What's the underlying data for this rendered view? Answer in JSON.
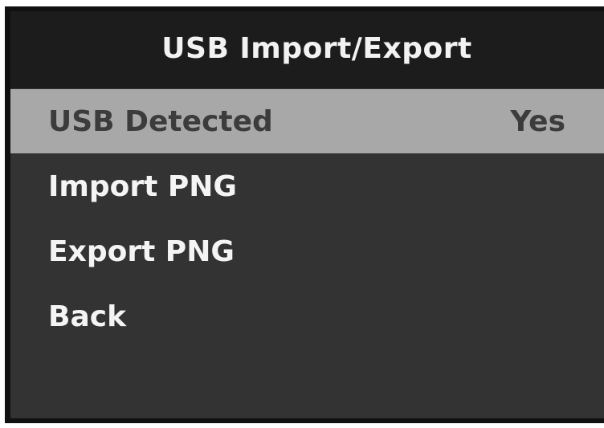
{
  "title": "USB Import/Export",
  "menu": {
    "items": [
      {
        "label": "USB Detected",
        "value": "Yes",
        "selected": true
      },
      {
        "label": "Import PNG",
        "value": ""
      },
      {
        "label": "Export PNG",
        "value": ""
      },
      {
        "label": "Back",
        "value": ""
      }
    ]
  },
  "colors": {
    "frame": "#101010",
    "screen_background": "#333333",
    "title_bar": "#1c1c1c",
    "selected_row": "#a8a8a8",
    "text": "#f4f4f4",
    "selected_text": "#3c3c3c"
  }
}
